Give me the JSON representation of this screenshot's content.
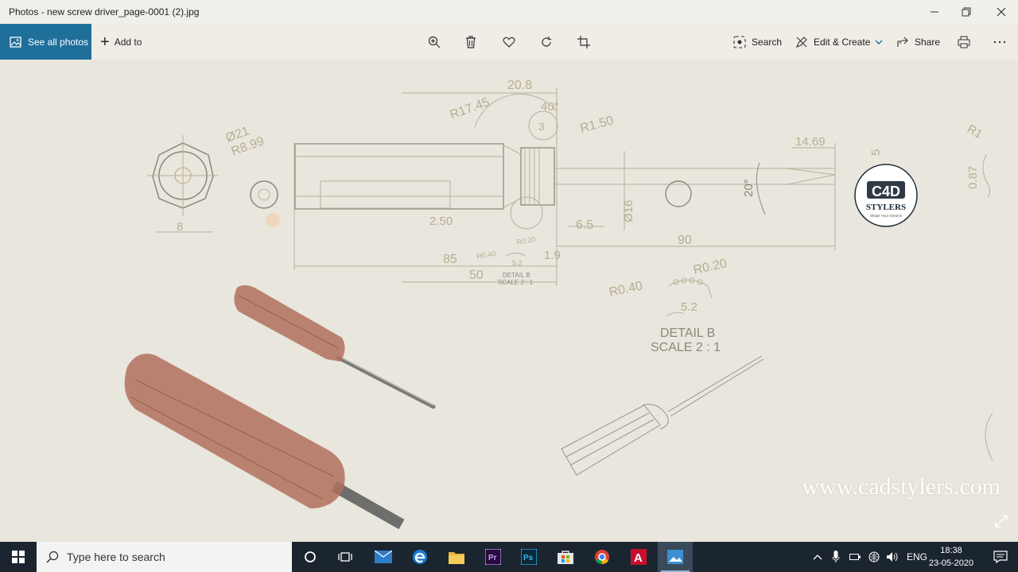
{
  "window": {
    "title": "Photos - new screw driver_page-0001 (2).jpg",
    "controls": [
      "minimize-icon",
      "maximize-icon",
      "close-icon"
    ]
  },
  "toolbar": {
    "see_all_label": "See all photos",
    "add_to_label": "Add to",
    "search_label": "Search",
    "edit_create_label": "Edit & Create",
    "share_label": "Share",
    "icons": [
      "zoom-icon",
      "delete-icon",
      "favorite-icon",
      "rotate-icon",
      "crop-icon",
      "print-icon",
      "more-icon"
    ]
  },
  "drawing": {
    "dimensions": [
      "20.8",
      "R17.45",
      "40°",
      "3",
      "R1.50",
      "Ø21",
      "R8.99",
      "14.69",
      "5",
      "R1",
      "0.87",
      "8",
      "2.50",
      "6.5",
      "Ø16",
      "20°",
      "90",
      "85",
      "1.9",
      "50",
      "R0.40",
      "R0.20",
      "5.2",
      "R0.20",
      "R0.40",
      "5.2"
    ],
    "detail_small": [
      "DETAIL B",
      "SCALE 2 : 1"
    ],
    "detail_large": [
      "DETAIL B",
      "SCALE 2 : 1"
    ],
    "logo_text": "STYLERS",
    "logo_tagline": "Shape Your Dreams"
  },
  "watermark": "www.cadstylers.com",
  "taskbar": {
    "search_placeholder": "Type here to search",
    "apps": [
      "cortana-icon",
      "task-view-icon",
      "mail-icon",
      "edge-icon",
      "file-explorer-icon",
      "premiere-icon",
      "photoshop-icon",
      "store-icon",
      "chrome-icon",
      "autocad-icon",
      "photos-icon"
    ],
    "language": "ENG",
    "time": "18:38",
    "date": "23-05-2020"
  },
  "colors": {
    "accent": "#1f6f9b",
    "taskbar": "#1b2530",
    "canvas": "#e9e6dd",
    "handle": "#b0705d"
  }
}
